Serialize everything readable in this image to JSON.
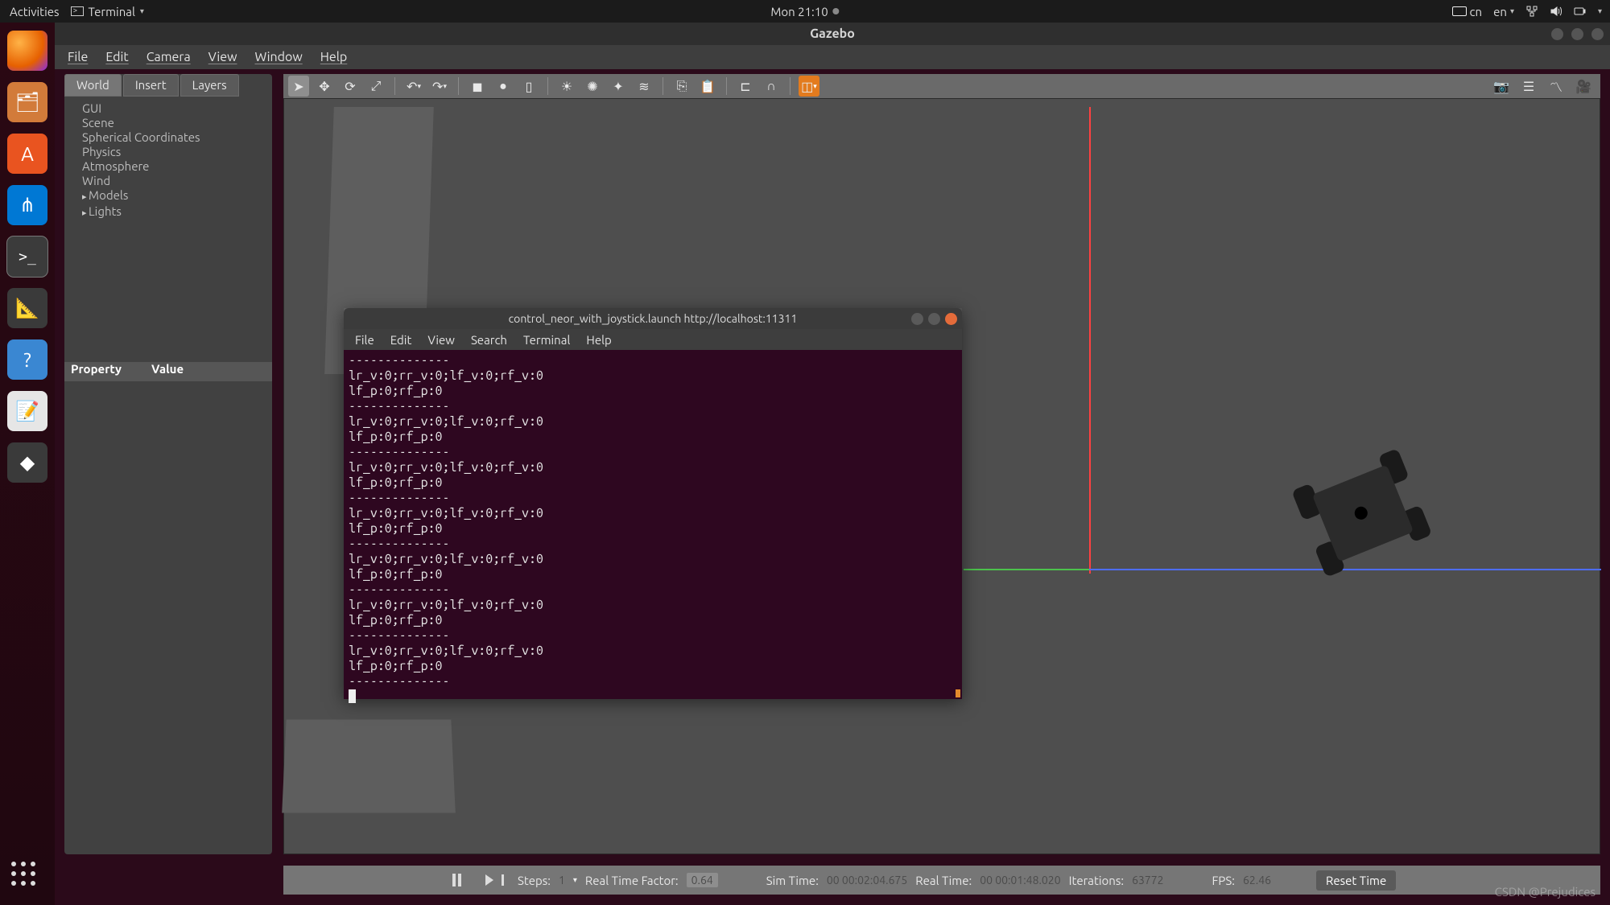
{
  "topbar": {
    "activities": "Activities",
    "app_label": "Terminal",
    "clock": "Mon 21:10",
    "input_method": "cn",
    "lang": "en"
  },
  "titlebar": {
    "app": "Gazebo"
  },
  "menubar": {
    "items": [
      "File",
      "Edit",
      "Camera",
      "View",
      "Window",
      "Help"
    ]
  },
  "sidebar": {
    "tabs": [
      {
        "label": "World",
        "active": true
      },
      {
        "label": "Insert",
        "active": false
      },
      {
        "label": "Layers",
        "active": false
      }
    ],
    "tree": [
      "GUI",
      "Scene",
      "Spherical Coordinates",
      "Physics",
      "Atmosphere",
      "Wind",
      "Models",
      "Lights"
    ],
    "prop_header": [
      "Property",
      "Value"
    ]
  },
  "toolbar": {
    "left": [
      "cursor",
      "move",
      "rotate",
      "scale",
      "undo",
      "redo"
    ],
    "shapes": [
      "box",
      "sphere",
      "cylinder"
    ],
    "lights": [
      "sun",
      "point",
      "spot",
      "grid"
    ],
    "clip": [
      "copy",
      "paste"
    ],
    "misc": [
      "snap",
      "magnet",
      "select-orange"
    ],
    "right": [
      "camera",
      "log",
      "graph",
      "record"
    ]
  },
  "bottombar": {
    "steps_lbl": "Steps:",
    "steps_val": "1",
    "rtf_lbl": "Real Time Factor:",
    "rtf_val": "0.64",
    "simtime_lbl": "Sim Time:",
    "simtime_val": "00 00:02:04.675",
    "realtime_lbl": "Real Time:",
    "realtime_val": "00 00:01:48.020",
    "iter_lbl": "Iterations:",
    "iter_val": "63772",
    "fps_lbl": "FPS:",
    "fps_val": "62.46",
    "reset": "Reset Time"
  },
  "terminal": {
    "title": "control_neor_with_joystick.launch http://localhost:11311",
    "menu": [
      "File",
      "Edit",
      "View",
      "Search",
      "Terminal",
      "Help"
    ],
    "lines": [
      "--------------",
      "lr_v:0;rr_v:0;lf_v:0;rf_v:0",
      "lf_p:0;rf_p:0",
      "--------------",
      "lr_v:0;rr_v:0;lf_v:0;rf_v:0",
      "lf_p:0;rf_p:0",
      "--------------",
      "lr_v:0;rr_v:0;lf_v:0;rf_v:0",
      "lf_p:0;rf_p:0",
      "--------------",
      "lr_v:0;rr_v:0;lf_v:0;rf_v:0",
      "lf_p:0;rf_p:0",
      "--------------",
      "lr_v:0;rr_v:0;lf_v:0;rf_v:0",
      "lf_p:0;rf_p:0",
      "--------------",
      "lr_v:0;rr_v:0;lf_v:0;rf_v:0",
      "lf_p:0;rf_p:0",
      "--------------",
      "lr_v:0;rr_v:0;lf_v:0;rf_v:0",
      "lf_p:0;rf_p:0",
      "--------------"
    ]
  },
  "watermark": "CSDN @Prejudices"
}
